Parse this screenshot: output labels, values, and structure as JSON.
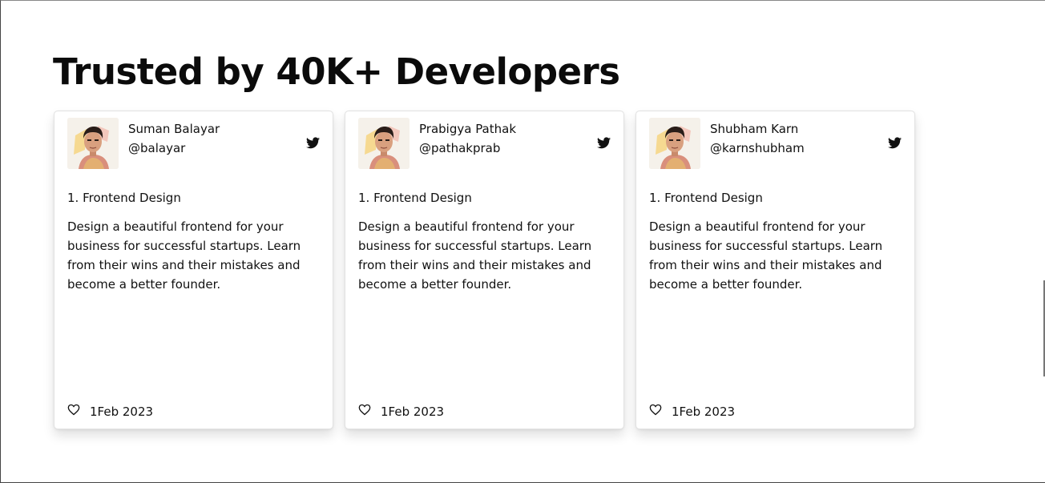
{
  "page": {
    "title": "Trusted by 40K+ Developers"
  },
  "cards": [
    {
      "name": "Suman Balayar",
      "handle": "@balayar",
      "post_title": "1. Frontend Design",
      "post_body": "Design a beautiful frontend for your business for successful startups. Learn from their wins and their mistakes and become a better founder.",
      "date": "1Feb 2023",
      "icons": {
        "social": "twitter-icon",
        "like": "heart-icon"
      }
    },
    {
      "name": "Prabigya Pathak",
      "handle": "@pathakprab",
      "post_title": "1. Frontend Design",
      "post_body": "Design a beautiful frontend for your business for successful startups. Learn from their wins and their mistakes and become a better founder.",
      "date": "1Feb 2023",
      "icons": {
        "social": "twitter-icon",
        "like": "heart-icon"
      }
    },
    {
      "name": "Shubham Karn",
      "handle": "@karnshubham",
      "post_title": "1. Frontend Design",
      "post_body": "Design a beautiful frontend for your business for successful startups. Learn from their wins and their mistakes and become a better founder.",
      "date": "1Feb 2023",
      "icons": {
        "social": "twitter-icon",
        "like": "heart-icon"
      }
    }
  ],
  "colors": {
    "text": "#111111",
    "card_border": "#e2e2e2",
    "background": "#ffffff"
  }
}
